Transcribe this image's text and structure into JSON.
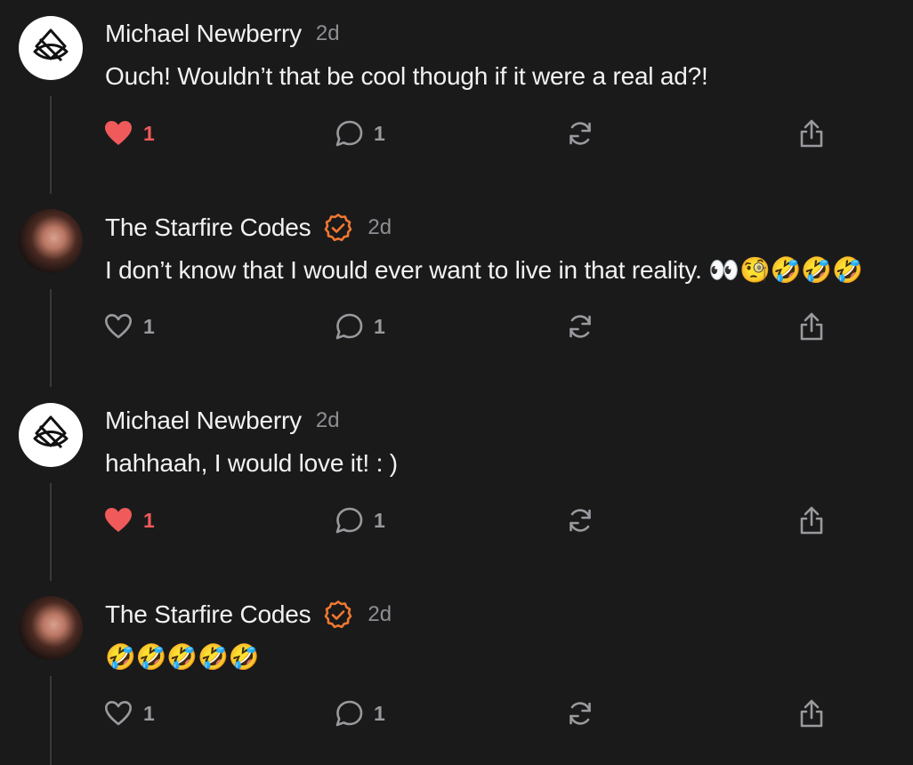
{
  "colors": {
    "background": "#1a1a1b",
    "like_active": "#f05a5a",
    "icon_muted": "#9a9a9e",
    "verified_badge": "#f07830"
  },
  "notes": [
    {
      "author": "Michael Newberry",
      "avatar": "logo",
      "verified": false,
      "time": "2d",
      "text": "Ouch! Wouldn’t that be cool though if it were a real ad?!",
      "liked": true,
      "like_count": "1",
      "reply_count": "1"
    },
    {
      "author": "The Starfire Codes",
      "avatar": "photo",
      "verified": true,
      "time": "2d",
      "text": "I don’t know that I would ever want to live in that reality. 👀🧐🤣🤣🤣",
      "liked": false,
      "like_count": "1",
      "reply_count": "1"
    },
    {
      "author": "Michael Newberry",
      "avatar": "logo",
      "verified": false,
      "time": "2d",
      "text": "hahhaah, I would love it! : )",
      "liked": true,
      "like_count": "1",
      "reply_count": "1"
    },
    {
      "author": "The Starfire Codes",
      "avatar": "photo",
      "verified": true,
      "time": "2d",
      "text": "🤣🤣🤣🤣🤣",
      "liked": false,
      "like_count": "1",
      "reply_count": "1"
    }
  ]
}
